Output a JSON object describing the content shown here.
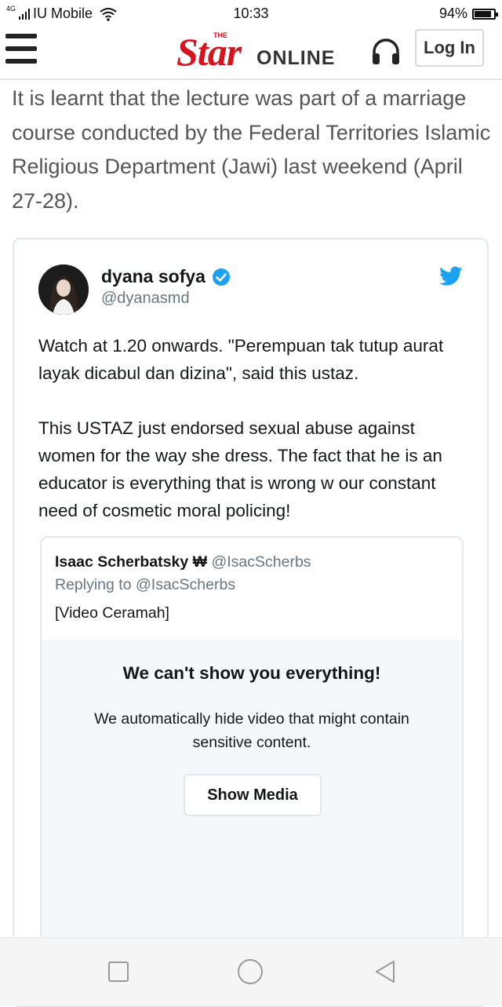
{
  "status_bar": {
    "network": "4G",
    "carrier": "IU Mobile",
    "time": "10:33",
    "battery_percent_label": "94%",
    "battery_level": 0.94
  },
  "header": {
    "logo_main": "Star",
    "logo_small": "THE",
    "logo_suffix": "ONLINE",
    "login_label": "Log In",
    "brand_color": "#d7141d",
    "menu_icon": "hamburger-menu-icon",
    "audio_icon": "headphones-icon"
  },
  "article": {
    "paragraph": "It is learnt that the lecture was part of a marriage course conducted by the Federal Territories Islamic Religious Department (Jawi) last weekend (April 27-28)."
  },
  "tweet": {
    "display_name": "dyana sofya",
    "handle": "@dyanasmd",
    "verified_icon": "verified-badge-icon",
    "platform_icon": "twitter-bird-icon",
    "accent_color": "#1da1f2",
    "body_paragraph_1": "Watch at 1.20 onwards. \"Perempuan tak tutup aurat layak dicabul dan dizina\", said this ustaz.",
    "body_paragraph_2": "This USTAZ just endorsed sexual abuse against women for the way she dress. The fact that he is an educator is everything that is wrong w our constant need of cosmetic moral policing!",
    "quoted": {
      "display_name": "Isaac Scherbatsky ₩",
      "handle": "@IsacScherbs",
      "replying_to": "Replying to @IsacScherbs",
      "text": "[Video Ceramah]",
      "sensitive_title": "We can't show you everything!",
      "sensitive_description": "We automatically hide video that might contain sensitive content.",
      "show_media_label": "Show Media"
    }
  },
  "nav_bar": {
    "recents_icon": "square-recents-icon",
    "home_icon": "circle-home-icon",
    "back_icon": "triangle-back-icon"
  }
}
